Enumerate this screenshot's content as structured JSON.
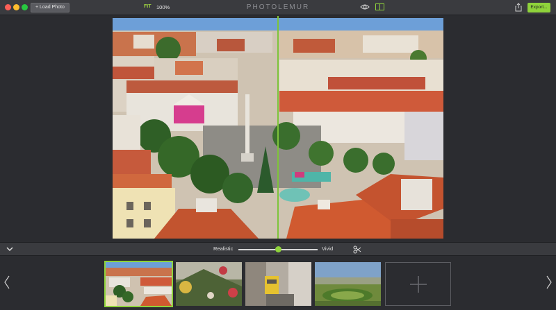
{
  "window": {
    "title": "PHOTOLEMUR"
  },
  "toolbar": {
    "load_photo_label": "+ Load Photo",
    "fit_label": "FIT",
    "zoom_value": "100%",
    "export_label": "Export...",
    "accent_color": "#8fd33b"
  },
  "icons": {
    "view": "eye-icon",
    "compare": "split-view-icon",
    "share": "share-icon",
    "collapse": "chevron-down-icon",
    "tools": "scissors-icon",
    "prev": "chevron-left-icon",
    "next": "chevron-right-icon",
    "add": "plus-icon"
  },
  "controls": {
    "left_label": "Realistic",
    "right_label": "Vivid",
    "slider_level": 0.5
  },
  "canvas": {
    "comparison_split": 0.5
  },
  "filmstrip": {
    "thumbnails": [
      {
        "subject": "city rooftops",
        "selected": true
      },
      {
        "subject": "christmas ornaments",
        "selected": false
      },
      {
        "subject": "yellow tram",
        "selected": false
      },
      {
        "subject": "park landscape",
        "selected": false
      }
    ]
  }
}
